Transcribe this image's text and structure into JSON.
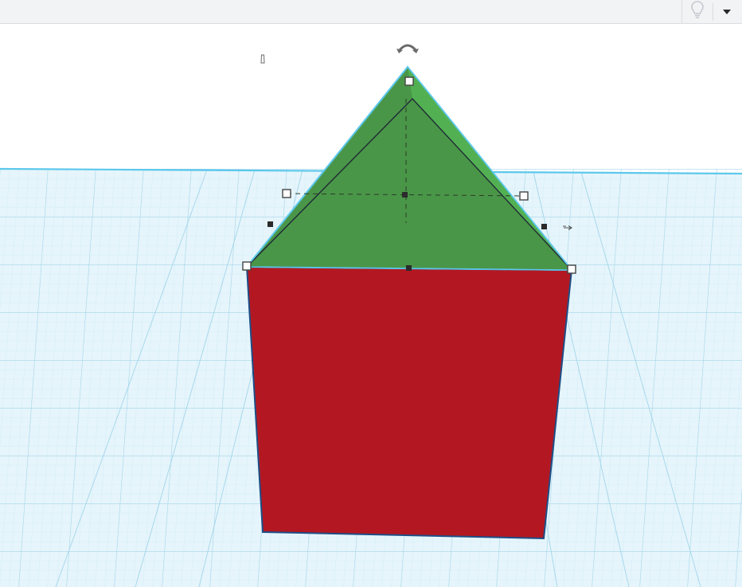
{
  "toolbar": {
    "icons": [
      "lightbulb-icon",
      "caret-down-icon"
    ]
  },
  "workplane": {
    "background": "#ffffff",
    "grid_fill": "#e6f5fb",
    "grid_line": "#a8d8ec",
    "horizon_color": "#5cc8ec"
  },
  "shapes": [
    {
      "name": "box",
      "color": "#b31822",
      "edge": "#1d4e87"
    },
    {
      "name": "roof",
      "color": "#4a9648",
      "side_color": "#52b052",
      "edge": "#1f2a36"
    }
  ],
  "selection": {
    "handle_color": "#ffffff",
    "handle_border": "#444444",
    "outline_color": "#5cc8ec",
    "icons": [
      "rotate-arrow-icon",
      "height-cone-icon",
      "move-arrow-icon"
    ]
  }
}
